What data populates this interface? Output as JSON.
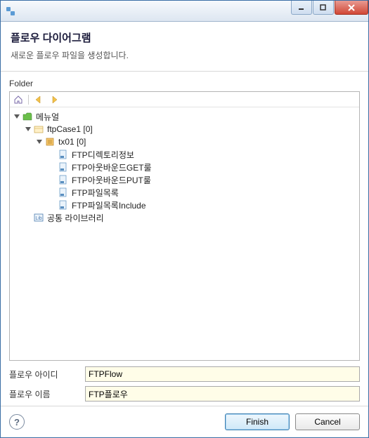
{
  "header": {
    "title": "플로우 다이어그램",
    "subtitle": "새로운 플로우 파일을 생성합니다."
  },
  "folder": {
    "label": "Folder",
    "toolbar": {
      "home": "home-icon",
      "back": "back-arrow-icon",
      "forward": "forward-arrow-icon"
    },
    "tree": {
      "root": {
        "label": "메뉴얼",
        "expanded": true
      },
      "ftpcase": {
        "label": "ftpCase1 [0]",
        "expanded": true
      },
      "tx01": {
        "label": "tx01 [0]",
        "expanded": true
      },
      "items": [
        {
          "label": "FTP디렉토리정보"
        },
        {
          "label": "FTP아웃바운드GET룰"
        },
        {
          "label": "FTP아웃바운드PUT룰"
        },
        {
          "label": "FTP파일목록"
        },
        {
          "label": "FTP파일목록Include"
        }
      ],
      "lib": {
        "label": "공통 라이브러리"
      }
    }
  },
  "form": {
    "flow_id_label": "플로우 아이디",
    "flow_id_value": "FTPFlow",
    "flow_name_label": "플로우 이름",
    "flow_name_value": "FTP플로우"
  },
  "footer": {
    "help": "?",
    "finish": "Finish",
    "cancel": "Cancel"
  }
}
